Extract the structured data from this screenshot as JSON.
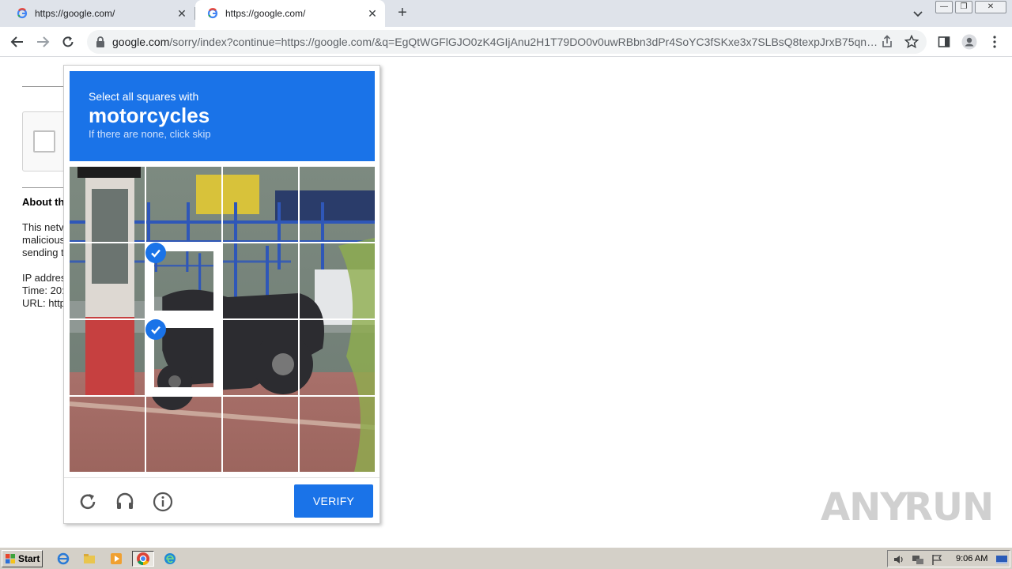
{
  "browser": {
    "tabs": [
      {
        "title": "https://google.com/",
        "active": false
      },
      {
        "title": "https://google.com/",
        "active": true
      }
    ],
    "new_tab": "+",
    "address": {
      "host": "google.com",
      "path": "/sorry/index?continue=https://google.com/&q=EgQtWGFlGJO0zK4GIjAnu2H1T79DO0v0uwRBbn3dPr4SoYC3fSKxe3x7SLBsQ8texpJrxB75qn1..."
    }
  },
  "page": {
    "about_heading": "About th",
    "lines": [
      "This netv",
      "malicious",
      "sending t",
      "IP addres",
      "Time: 20:",
      "URL: http"
    ]
  },
  "captcha": {
    "instruction": "Select all squares with",
    "target": "motorcycles",
    "hint": "If there are none, click skip",
    "grid_size": 4,
    "selected_cells": [
      5,
      9
    ],
    "verify_label": "VERIFY",
    "accent": "#1a73e8"
  },
  "watermark": {
    "left": "ANY",
    "right": "RUN"
  },
  "taskbar": {
    "start_label": "Start",
    "clock": "9:06 AM"
  }
}
